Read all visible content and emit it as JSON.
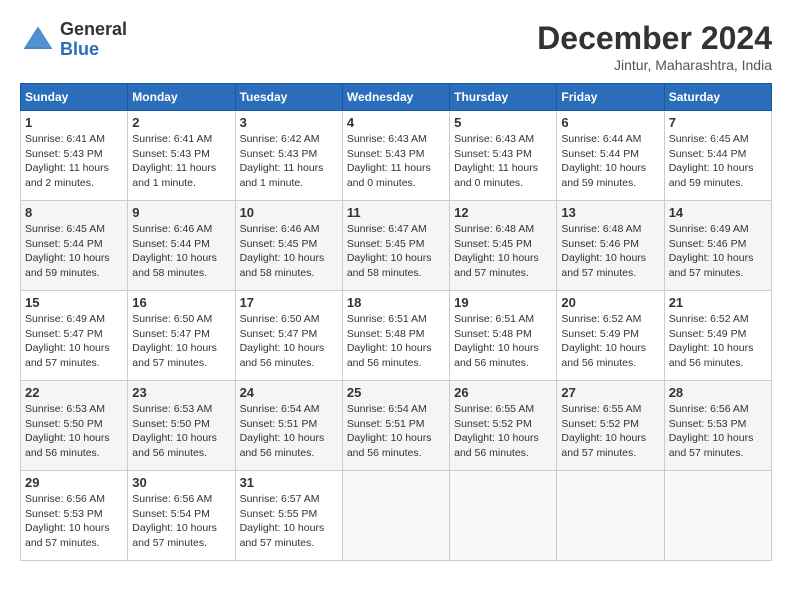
{
  "header": {
    "logo_general": "General",
    "logo_blue": "Blue",
    "title": "December 2024",
    "location": "Jintur, Maharashtra, India"
  },
  "weekdays": [
    "Sunday",
    "Monday",
    "Tuesday",
    "Wednesday",
    "Thursday",
    "Friday",
    "Saturday"
  ],
  "weeks": [
    [
      {
        "day": "1",
        "info": "Sunrise: 6:41 AM\nSunset: 5:43 PM\nDaylight: 11 hours and 2 minutes."
      },
      {
        "day": "2",
        "info": "Sunrise: 6:41 AM\nSunset: 5:43 PM\nDaylight: 11 hours and 1 minute."
      },
      {
        "day": "3",
        "info": "Sunrise: 6:42 AM\nSunset: 5:43 PM\nDaylight: 11 hours and 1 minute."
      },
      {
        "day": "4",
        "info": "Sunrise: 6:43 AM\nSunset: 5:43 PM\nDaylight: 11 hours and 0 minutes."
      },
      {
        "day": "5",
        "info": "Sunrise: 6:43 AM\nSunset: 5:43 PM\nDaylight: 11 hours and 0 minutes."
      },
      {
        "day": "6",
        "info": "Sunrise: 6:44 AM\nSunset: 5:44 PM\nDaylight: 10 hours and 59 minutes."
      },
      {
        "day": "7",
        "info": "Sunrise: 6:45 AM\nSunset: 5:44 PM\nDaylight: 10 hours and 59 minutes."
      }
    ],
    [
      {
        "day": "8",
        "info": "Sunrise: 6:45 AM\nSunset: 5:44 PM\nDaylight: 10 hours and 59 minutes."
      },
      {
        "day": "9",
        "info": "Sunrise: 6:46 AM\nSunset: 5:44 PM\nDaylight: 10 hours and 58 minutes."
      },
      {
        "day": "10",
        "info": "Sunrise: 6:46 AM\nSunset: 5:45 PM\nDaylight: 10 hours and 58 minutes."
      },
      {
        "day": "11",
        "info": "Sunrise: 6:47 AM\nSunset: 5:45 PM\nDaylight: 10 hours and 58 minutes."
      },
      {
        "day": "12",
        "info": "Sunrise: 6:48 AM\nSunset: 5:45 PM\nDaylight: 10 hours and 57 minutes."
      },
      {
        "day": "13",
        "info": "Sunrise: 6:48 AM\nSunset: 5:46 PM\nDaylight: 10 hours and 57 minutes."
      },
      {
        "day": "14",
        "info": "Sunrise: 6:49 AM\nSunset: 5:46 PM\nDaylight: 10 hours and 57 minutes."
      }
    ],
    [
      {
        "day": "15",
        "info": "Sunrise: 6:49 AM\nSunset: 5:47 PM\nDaylight: 10 hours and 57 minutes."
      },
      {
        "day": "16",
        "info": "Sunrise: 6:50 AM\nSunset: 5:47 PM\nDaylight: 10 hours and 57 minutes."
      },
      {
        "day": "17",
        "info": "Sunrise: 6:50 AM\nSunset: 5:47 PM\nDaylight: 10 hours and 56 minutes."
      },
      {
        "day": "18",
        "info": "Sunrise: 6:51 AM\nSunset: 5:48 PM\nDaylight: 10 hours and 56 minutes."
      },
      {
        "day": "19",
        "info": "Sunrise: 6:51 AM\nSunset: 5:48 PM\nDaylight: 10 hours and 56 minutes."
      },
      {
        "day": "20",
        "info": "Sunrise: 6:52 AM\nSunset: 5:49 PM\nDaylight: 10 hours and 56 minutes."
      },
      {
        "day": "21",
        "info": "Sunrise: 6:52 AM\nSunset: 5:49 PM\nDaylight: 10 hours and 56 minutes."
      }
    ],
    [
      {
        "day": "22",
        "info": "Sunrise: 6:53 AM\nSunset: 5:50 PM\nDaylight: 10 hours and 56 minutes."
      },
      {
        "day": "23",
        "info": "Sunrise: 6:53 AM\nSunset: 5:50 PM\nDaylight: 10 hours and 56 minutes."
      },
      {
        "day": "24",
        "info": "Sunrise: 6:54 AM\nSunset: 5:51 PM\nDaylight: 10 hours and 56 minutes."
      },
      {
        "day": "25",
        "info": "Sunrise: 6:54 AM\nSunset: 5:51 PM\nDaylight: 10 hours and 56 minutes."
      },
      {
        "day": "26",
        "info": "Sunrise: 6:55 AM\nSunset: 5:52 PM\nDaylight: 10 hours and 56 minutes."
      },
      {
        "day": "27",
        "info": "Sunrise: 6:55 AM\nSunset: 5:52 PM\nDaylight: 10 hours and 57 minutes."
      },
      {
        "day": "28",
        "info": "Sunrise: 6:56 AM\nSunset: 5:53 PM\nDaylight: 10 hours and 57 minutes."
      }
    ],
    [
      {
        "day": "29",
        "info": "Sunrise: 6:56 AM\nSunset: 5:53 PM\nDaylight: 10 hours and 57 minutes."
      },
      {
        "day": "30",
        "info": "Sunrise: 6:56 AM\nSunset: 5:54 PM\nDaylight: 10 hours and 57 minutes."
      },
      {
        "day": "31",
        "info": "Sunrise: 6:57 AM\nSunset: 5:55 PM\nDaylight: 10 hours and 57 minutes."
      },
      {
        "day": "",
        "info": ""
      },
      {
        "day": "",
        "info": ""
      },
      {
        "day": "",
        "info": ""
      },
      {
        "day": "",
        "info": ""
      }
    ]
  ]
}
